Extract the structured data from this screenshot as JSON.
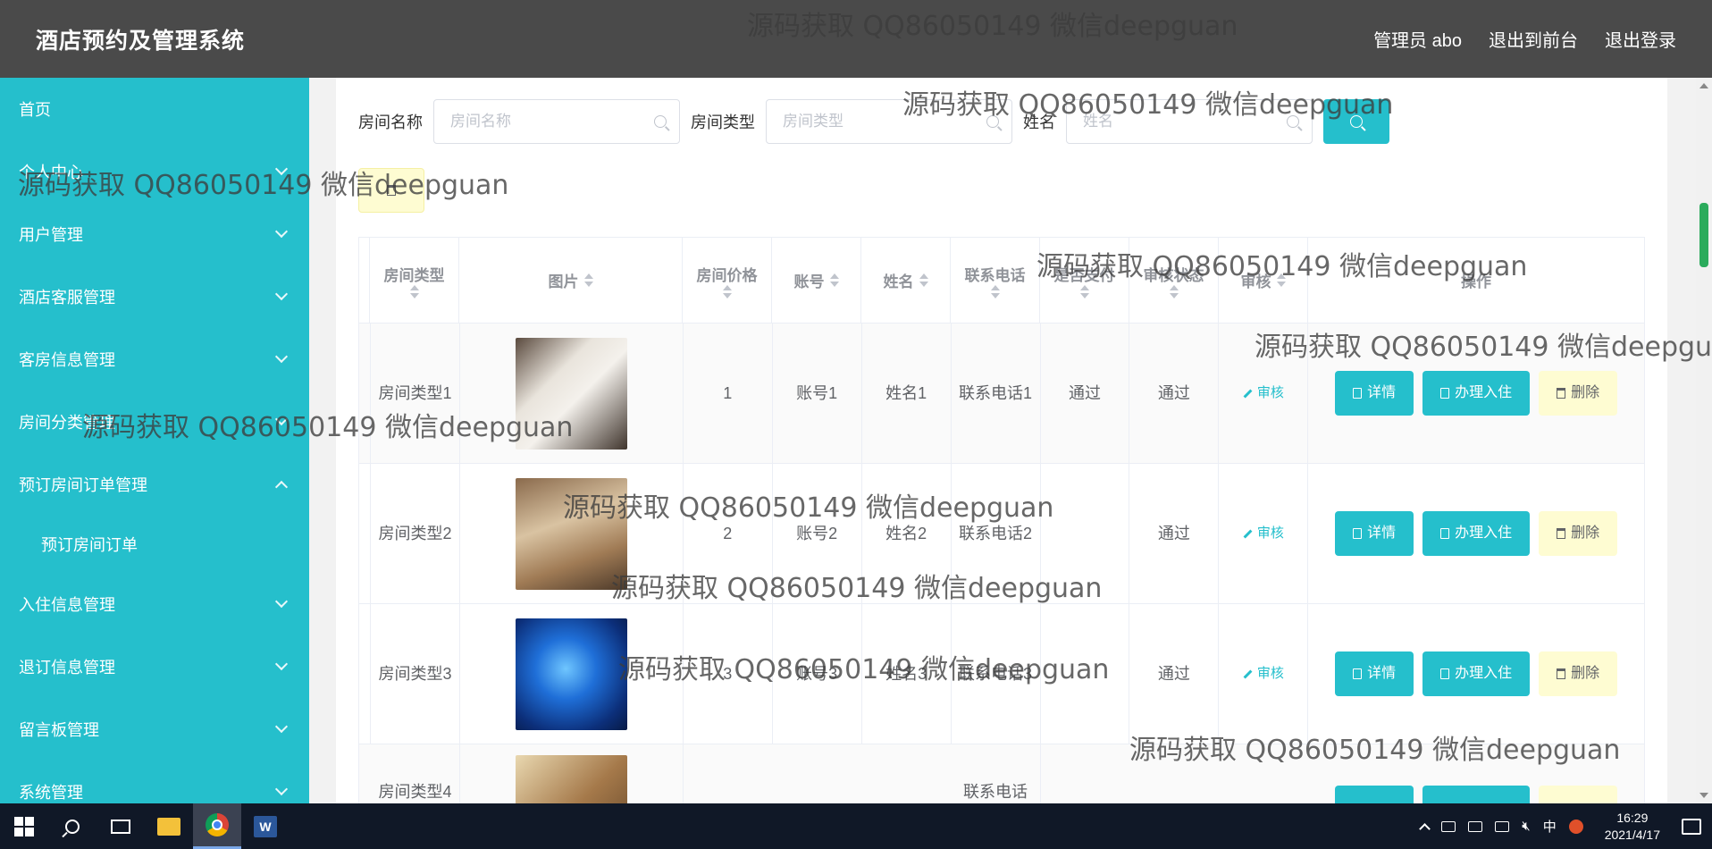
{
  "header": {
    "title": "酒店预约及管理系统",
    "admin": "管理员 abo",
    "exit_front": "退出到前台",
    "logout": "退出登录"
  },
  "sidebar": {
    "items": [
      {
        "label": "首页"
      },
      {
        "label": "个人中心"
      },
      {
        "label": "用户管理"
      },
      {
        "label": "酒店客服管理"
      },
      {
        "label": "客房信息管理"
      },
      {
        "label": "房间分类管理"
      },
      {
        "label": "预订房间订单管理"
      },
      {
        "label": "预订房间订单"
      },
      {
        "label": "入住信息管理"
      },
      {
        "label": "退订信息管理"
      },
      {
        "label": "留言板管理"
      },
      {
        "label": "系统管理"
      }
    ]
  },
  "search": {
    "room_name_label": "房间名称",
    "room_name_placeholder": "房间名称",
    "room_type_label": "房间类型",
    "room_type_placeholder": "房间类型",
    "name_label": "姓名",
    "name_placeholder": "姓名"
  },
  "table": {
    "headers": [
      "房间类型",
      "图片",
      "房间价格",
      "账号",
      "姓名",
      "联系电话",
      "是否支付",
      "审核状态",
      "审核",
      "操作"
    ],
    "rows": [
      {
        "room_type": "房间类型1",
        "price": "1",
        "account": "账号1",
        "name": "姓名1",
        "phone": "联系电话1",
        "paid": "通过",
        "status": "通过",
        "audit": "审核"
      },
      {
        "room_type": "房间类型2",
        "price": "2",
        "account": "账号2",
        "name": "姓名2",
        "phone": "联系电话2",
        "paid": "",
        "status": "通过",
        "audit": "审核"
      },
      {
        "room_type": "房间类型3",
        "price": "3",
        "account": "账号3",
        "name": "姓名3",
        "phone": "联系电话3",
        "paid": "",
        "status": "通过",
        "audit": "审核"
      },
      {
        "room_type": "房间类型4",
        "price": "",
        "account": "",
        "name": "",
        "phone": "联系电话",
        "paid": "",
        "status": "",
        "audit": ""
      }
    ],
    "btn_detail": "详情",
    "btn_checkin": "办理入住",
    "btn_delete": "删除"
  },
  "watermark": "源码获取 QQ86050149 微信deepguan",
  "taskbar": {
    "time": "16:29",
    "date": "2021/4/17",
    "ime": "中",
    "word_glyph": "W"
  },
  "colors": {
    "accent": "#25bfcc",
    "header_bg": "#4a4a4a",
    "delete_bg": "#fefcd2"
  }
}
